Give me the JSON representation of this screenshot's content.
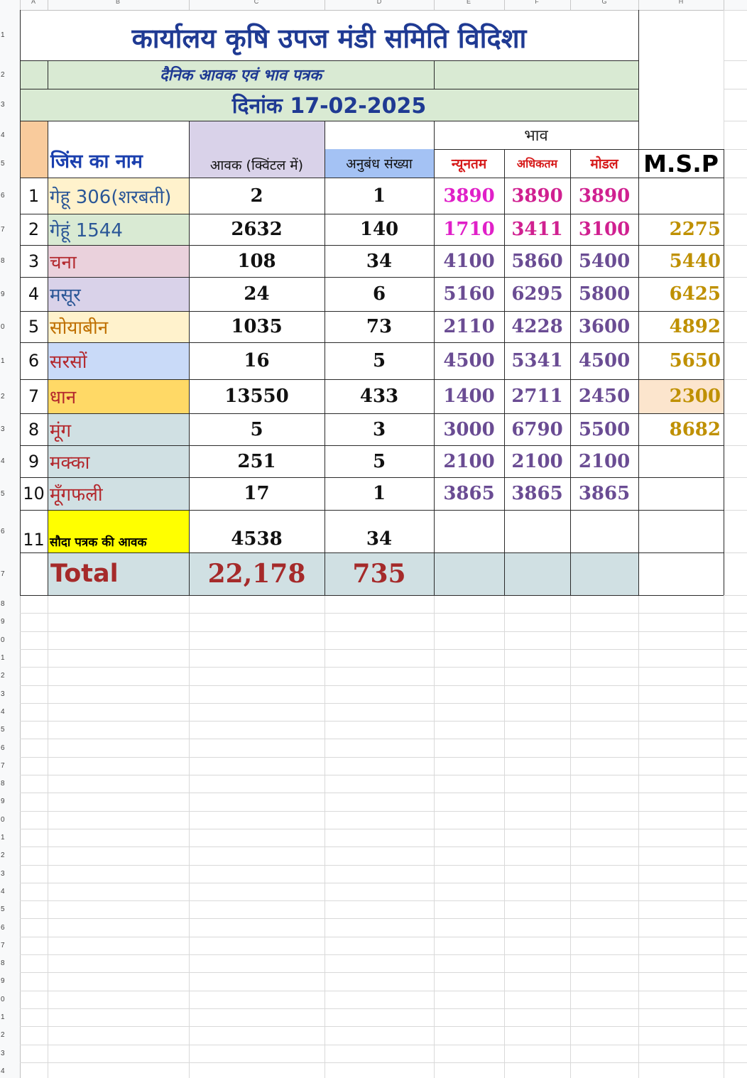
{
  "colors": {
    "title_blue": "#1f3a93",
    "title_band": "#d9ead3",
    "name_blue": "#2b5797",
    "name_red": "#b3282d",
    "min_pink": "#e020c8",
    "max_purple": "#8a2be2",
    "price_purple": "#6a4c93",
    "msp_gold": "#bf9000",
    "total_red": "#a52a2a",
    "yellow": "#ffff00"
  },
  "column_letters": [
    "A",
    "B",
    "C",
    "D",
    "E",
    "F",
    "G",
    "H"
  ],
  "header": {
    "title": "कार्यालय कृषि उपज मंडी समिति विदिशा",
    "subtitle": "दैनिक आवक एवं भाव पत्रक",
    "date": "दिनांक 17-02-2025"
  },
  "table_header": {
    "price_group": "भाव",
    "name": "जिंस का नाम",
    "arrival": "आवक (क्विंटल में)",
    "contracts": "अनुबंध संख्या",
    "min": "न्यूनतम",
    "max": "अधिकतम",
    "modal": "मोडल",
    "msp": "M.S.P"
  },
  "rows": [
    {
      "sn": "1",
      "name": "गेहू 306(शरबती)",
      "arrival": "2",
      "contracts": "1",
      "min": "3890",
      "max": "3890",
      "modal": "3890",
      "msp": ""
    },
    {
      "sn": "2",
      "name": "गेहूं 1544",
      "arrival": "2632",
      "contracts": "140",
      "min": "1710",
      "max": "3411",
      "modal": "3100",
      "msp": "2275"
    },
    {
      "sn": "3",
      "name": "चना",
      "arrival": "108",
      "contracts": "34",
      "min": "4100",
      "max": "5860",
      "modal": "5400",
      "msp": "5440"
    },
    {
      "sn": "4",
      "name": "मसूर",
      "arrival": "24",
      "contracts": "6",
      "min": "5160",
      "max": "6295",
      "modal": "5800",
      "msp": "6425"
    },
    {
      "sn": "5",
      "name": "सोयाबीन",
      "arrival": "1035",
      "contracts": "73",
      "min": "2110",
      "max": "4228",
      "modal": "3600",
      "msp": "4892"
    },
    {
      "sn": "6",
      "name": "सरसों",
      "arrival": "16",
      "contracts": "5",
      "min": "4500",
      "max": "5341",
      "modal": "4500",
      "msp": "5650"
    },
    {
      "sn": "7",
      "name": "धान",
      "arrival": "13550",
      "contracts": "433",
      "min": "1400",
      "max": "2711",
      "modal": "2450",
      "msp": "2300"
    },
    {
      "sn": "8",
      "name": "मूंग",
      "arrival": "5",
      "contracts": "3",
      "min": "3000",
      "max": "6790",
      "modal": "5500",
      "msp": "8682"
    },
    {
      "sn": "9",
      "name": "मक्का",
      "arrival": "251",
      "contracts": "5",
      "min": "2100",
      "max": "2100",
      "modal": "2100",
      "msp": ""
    },
    {
      "sn": "10",
      "name": "मूँगफली",
      "arrival": "17",
      "contracts": "1",
      "min": "3865",
      "max": "3865",
      "modal": "3865",
      "msp": ""
    },
    {
      "sn": "11",
      "name": "सौदा पत्रक की आवक",
      "arrival": "4538",
      "contracts": "34",
      "min": "",
      "max": "",
      "modal": "",
      "msp": ""
    }
  ],
  "total": {
    "label": "Total",
    "arrival": "22,178",
    "contracts": "735"
  },
  "row_numbers": [
    "1",
    "2",
    "3",
    "4",
    "5",
    "6",
    "7",
    "8",
    "9",
    "0",
    "1",
    "2",
    "3",
    "4",
    "5",
    "6",
    "7",
    "8",
    "9",
    "0",
    "1",
    "2",
    "3",
    "4",
    "5",
    "6",
    "7",
    "8",
    "9",
    "0",
    "1",
    "2",
    "3",
    "4",
    "5",
    "6",
    "7",
    "8",
    "9",
    "0",
    "1",
    "2",
    "3",
    "4"
  ]
}
